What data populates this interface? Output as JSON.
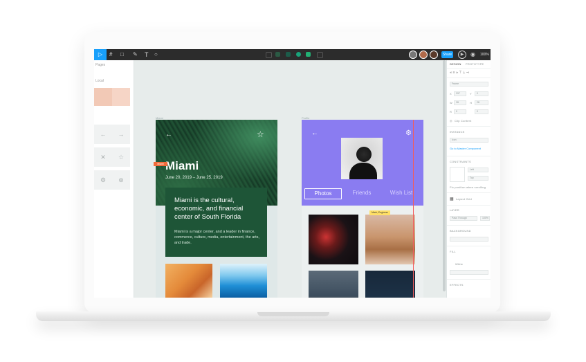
{
  "toolbar": {
    "move_tool": "▷",
    "frame_tool": "#",
    "shape_tool": "□",
    "pen_tool": "✎",
    "text_tool": "T",
    "comment_tool": "○",
    "share_label": "Share",
    "zoom": "100%",
    "accent": "#18a0fb"
  },
  "left_panel": {
    "section_pages": "Pages",
    "section_assets": "Local",
    "icons": [
      "arrow-left-icon",
      "arrow-right-icon",
      "close-icon",
      "star-icon",
      "settings-icon",
      "compass-icon"
    ]
  },
  "frame_miami": {
    "label": "Miami",
    "selection_tag": "Miami",
    "title": "Miami",
    "dates": "June 20, 2019 – June 25, 2019",
    "headline": "Miami is the cultural, economic, and financial center of South Florida",
    "body": "Miami is a major center, and a leader in finance, commerce, culture, media, entertainment, the arts, and trade."
  },
  "frame_profile": {
    "label": "Profile",
    "tabs": [
      "Photos",
      "Friends",
      "Wish List"
    ],
    "active_tab": "Photos",
    "note_tag": "Mark, Engineer"
  },
  "right_panel": {
    "tab_design": "DESIGN",
    "tab_prototype": "PROTOTYPE",
    "frame_type": "Frame",
    "x": "X",
    "x_val": "297",
    "y": "Y",
    "y_val": "0",
    "w": "W",
    "w_val": "28",
    "h": "H",
    "h_val": "28",
    "r": "R",
    "r_val": "0",
    "clip_content": "Clip Content",
    "section_instance": "INSTANCE",
    "instance_name": "Icon",
    "go_to_master": "Go to Master Component",
    "section_constraints": "CONSTRAINTS",
    "constraint_h": "Left",
    "constraint_v": "Top",
    "fix_position": "Fix position when scrolling",
    "layout_grid": "Layout Grid",
    "section_layer": "LAYER",
    "blend": "Pass Through",
    "opacity": "100%",
    "section_background": "BACKGROUND",
    "section_fill": "FILL",
    "fill_color": "White",
    "section_effects": "EFFECTS"
  }
}
